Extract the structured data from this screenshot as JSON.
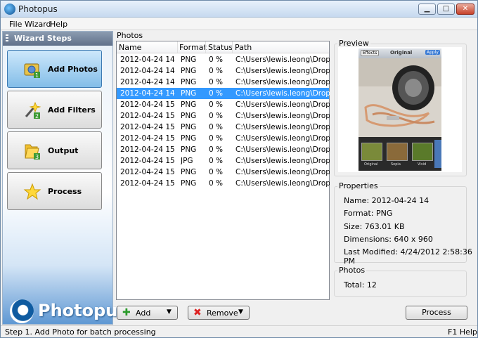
{
  "window": {
    "title": "Photopus",
    "minimize": "▁",
    "maximize": "□",
    "close": "✕"
  },
  "menu": {
    "file": "File",
    "wizard": "Wizard",
    "help": "Help"
  },
  "sidebar": {
    "header": "Wizard Steps",
    "steps": [
      {
        "label": "Add Photos",
        "icon": "add-photos-icon"
      },
      {
        "label": "Add Filters",
        "icon": "magic-wand-icon"
      },
      {
        "label": "Output",
        "icon": "folder-icon"
      },
      {
        "label": "Process",
        "icon": "star-icon"
      }
    ],
    "brand": "Photopus"
  },
  "photos": {
    "group_title": "Photos",
    "columns": [
      "Name",
      "Format",
      "Status",
      "Path"
    ],
    "rows": [
      [
        "2012-04-24 14",
        "PNG",
        "0 %",
        "C:\\Users\\lewis.leong\\Dropb..."
      ],
      [
        "2012-04-24 14",
        "PNG",
        "0 %",
        "C:\\Users\\lewis.leong\\Dropb..."
      ],
      [
        "2012-04-24 14",
        "PNG",
        "0 %",
        "C:\\Users\\lewis.leong\\Dropb..."
      ],
      [
        "2012-04-24 14",
        "PNG",
        "0 %",
        "C:\\Users\\lewis.leong\\Dropb..."
      ],
      [
        "2012-04-24 15",
        "PNG",
        "0 %",
        "C:\\Users\\lewis.leong\\Dropb..."
      ],
      [
        "2012-04-24 15",
        "PNG",
        "0 %",
        "C:\\Users\\lewis.leong\\Dropb..."
      ],
      [
        "2012-04-24 15",
        "PNG",
        "0 %",
        "C:\\Users\\lewis.leong\\Dropb..."
      ],
      [
        "2012-04-24 15",
        "PNG",
        "0 %",
        "C:\\Users\\lewis.leong\\Dropb..."
      ],
      [
        "2012-04-24 15",
        "PNG",
        "0 %",
        "C:\\Users\\lewis.leong\\Dropb..."
      ],
      [
        "2012-04-24 15",
        "JPG",
        "0 %",
        "C:\\Users\\lewis.leong\\Dropb..."
      ],
      [
        "2012-04-24 15",
        "PNG",
        "0 %",
        "C:\\Users\\lewis.leong\\Dropb..."
      ],
      [
        "2012-04-24 15",
        "PNG",
        "0 %",
        "C:\\Users\\lewis.leong\\Dropb..."
      ]
    ],
    "selected_index": 3
  },
  "preview": {
    "group_title": "Preview",
    "phone_labels": {
      "left": "Effects",
      "center": "Original",
      "right": "Apply"
    },
    "filmstrip": [
      "Original",
      "Sepia",
      "Vivid"
    ]
  },
  "properties": {
    "group_title": "Properties",
    "name": "Name: 2012-04-24 14",
    "format": "Format: PNG",
    "size": "Size: 763.01 KB",
    "dimensions": "Dimensions: 640 x 960",
    "modified": "Last Modified: 4/24/2012 2:58:36 PM"
  },
  "photos_summary": {
    "group_title": "Photos",
    "total": "Total: 12"
  },
  "buttons": {
    "add": "Add",
    "remove": "Remove",
    "process": "Process"
  },
  "status": {
    "left": "Step 1. Add Photo for batch processing",
    "right": "F1 Help"
  },
  "colors": {
    "selection": "#3399ff",
    "accent": "#0b4c8c"
  }
}
